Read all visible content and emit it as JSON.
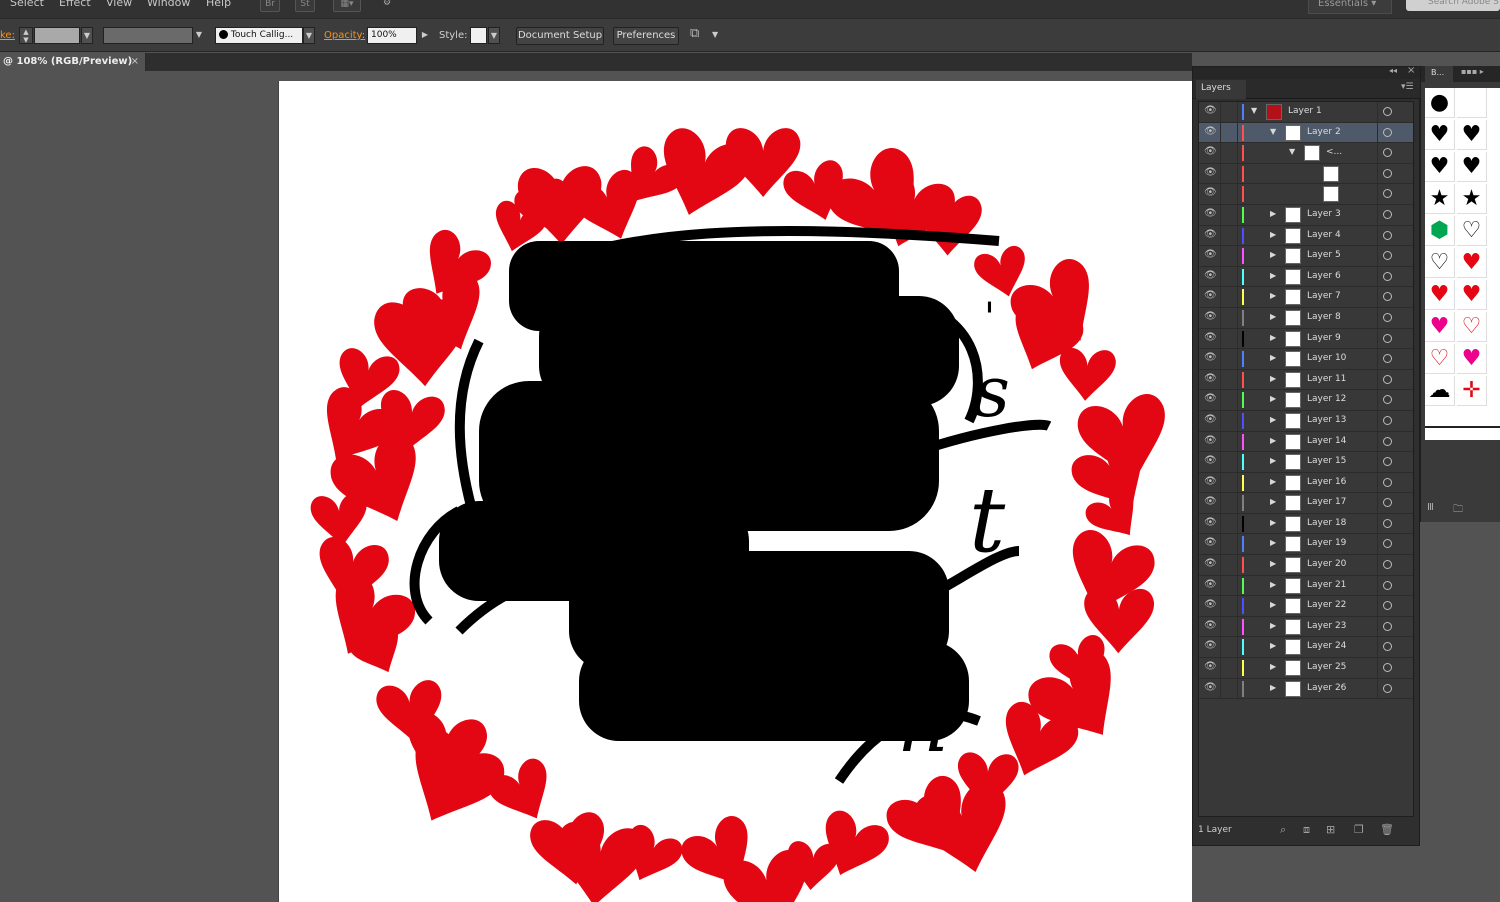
{
  "menubar": {
    "items": [
      "Select",
      "Effect",
      "View",
      "Window",
      "Help"
    ],
    "app_buttons": [
      "Br",
      "St"
    ],
    "workspace": "Essentials",
    "search_placeholder": "Search Adobe S"
  },
  "controlbar": {
    "stroke_label": "ke:",
    "brush_name": "Touch Callig...",
    "opacity_label": "Opacity:",
    "opacity_value": "100%",
    "style_label": "Style:",
    "document_setup": "Document Setup",
    "preferences": "Preferences"
  },
  "document": {
    "tab_title": "@ 108% (RGB/Preview)",
    "close": "×"
  },
  "colors": {
    "heart_red": "#e30613",
    "artboard": "#ffffff",
    "selection": "#4e5a6a"
  },
  "layers_panel": {
    "tab": "Layers",
    "footer_count": "1 Layer",
    "rows": [
      {
        "name": "Layer 1",
        "indent": 0,
        "expanded": true,
        "color": "#4f7fff",
        "selected": false,
        "thumb": "red"
      },
      {
        "name": "Layer 2",
        "indent": 1,
        "expanded": true,
        "color": "#ff4f4f",
        "selected": true,
        "thumb": "text"
      },
      {
        "name": "<...",
        "indent": 2,
        "expanded": true,
        "color": "#ff4f4f",
        "selected": false,
        "thumb": "text"
      },
      {
        "name": "",
        "indent": 3,
        "expanded": null,
        "color": "#ff4f4f",
        "selected": false,
        "thumb": "blank"
      },
      {
        "name": "",
        "indent": 3,
        "expanded": null,
        "color": "#ff4f4f",
        "selected": false,
        "thumb": "text"
      },
      {
        "name": "Layer 3",
        "indent": 1,
        "expanded": false,
        "color": "#4fff4f",
        "selected": false,
        "thumb": "text"
      },
      {
        "name": "Layer 4",
        "indent": 1,
        "expanded": false,
        "color": "#4f4fff",
        "selected": false,
        "thumb": "text"
      },
      {
        "name": "Layer 5",
        "indent": 1,
        "expanded": false,
        "color": "#ff4fff",
        "selected": false,
        "thumb": "text"
      },
      {
        "name": "Layer 6",
        "indent": 1,
        "expanded": false,
        "color": "#4fffff",
        "selected": false,
        "thumb": "text"
      },
      {
        "name": "Layer 7",
        "indent": 1,
        "expanded": false,
        "color": "#ffff4f",
        "selected": false,
        "thumb": "text"
      },
      {
        "name": "Layer 8",
        "indent": 1,
        "expanded": false,
        "color": "#808080",
        "selected": false,
        "thumb": "text"
      },
      {
        "name": "Layer 9",
        "indent": 1,
        "expanded": false,
        "color": "#000000",
        "selected": false,
        "thumb": "text"
      },
      {
        "name": "Layer 10",
        "indent": 1,
        "expanded": false,
        "color": "#4f7fff",
        "selected": false,
        "thumb": "text"
      },
      {
        "name": "Layer 11",
        "indent": 1,
        "expanded": false,
        "color": "#ff4f4f",
        "selected": false,
        "thumb": "text"
      },
      {
        "name": "Layer 12",
        "indent": 1,
        "expanded": false,
        "color": "#4fff4f",
        "selected": false,
        "thumb": "text"
      },
      {
        "name": "Layer 13",
        "indent": 1,
        "expanded": false,
        "color": "#4f4fff",
        "selected": false,
        "thumb": "text"
      },
      {
        "name": "Layer 14",
        "indent": 1,
        "expanded": false,
        "color": "#ff4fff",
        "selected": false,
        "thumb": "text"
      },
      {
        "name": "Layer 15",
        "indent": 1,
        "expanded": false,
        "color": "#4fffff",
        "selected": false,
        "thumb": "text"
      },
      {
        "name": "Layer 16",
        "indent": 1,
        "expanded": false,
        "color": "#ffff4f",
        "selected": false,
        "thumb": "text"
      },
      {
        "name": "Layer 17",
        "indent": 1,
        "expanded": false,
        "color": "#808080",
        "selected": false,
        "thumb": "text"
      },
      {
        "name": "Layer 18",
        "indent": 1,
        "expanded": false,
        "color": "#000000",
        "selected": false,
        "thumb": "text"
      },
      {
        "name": "Layer 19",
        "indent": 1,
        "expanded": false,
        "color": "#4f7fff",
        "selected": false,
        "thumb": "text"
      },
      {
        "name": "Layer 20",
        "indent": 1,
        "expanded": false,
        "color": "#ff4f4f",
        "selected": false,
        "thumb": "text"
      },
      {
        "name": "Layer 21",
        "indent": 1,
        "expanded": false,
        "color": "#4fff4f",
        "selected": false,
        "thumb": "text"
      },
      {
        "name": "Layer 22",
        "indent": 1,
        "expanded": false,
        "color": "#4f4fff",
        "selected": false,
        "thumb": "text"
      },
      {
        "name": "Layer 23",
        "indent": 1,
        "expanded": false,
        "color": "#ff4fff",
        "selected": false,
        "thumb": "text"
      },
      {
        "name": "Layer 24",
        "indent": 1,
        "expanded": false,
        "color": "#4fffff",
        "selected": false,
        "thumb": "text"
      },
      {
        "name": "Layer 25",
        "indent": 1,
        "expanded": false,
        "color": "#ffff4f",
        "selected": false,
        "thumb": "text"
      },
      {
        "name": "Layer 26",
        "indent": 1,
        "expanded": false,
        "color": "#808080",
        "selected": false,
        "thumb": "text"
      }
    ]
  },
  "symbols_panel": {
    "tab": "B...",
    "symbols": [
      {
        "glyph": "●",
        "color": "#000000"
      },
      {
        "glyph": "",
        "color": "#000000"
      },
      {
        "glyph": "♥",
        "color": "#000000"
      },
      {
        "glyph": "♥",
        "color": "#000000"
      },
      {
        "glyph": "♥",
        "color": "#000000"
      },
      {
        "glyph": "♥",
        "color": "#000000"
      },
      {
        "glyph": "★",
        "color": "#000000"
      },
      {
        "glyph": "★",
        "color": "#000000"
      },
      {
        "glyph": "⬢",
        "color": "#00a651"
      },
      {
        "glyph": "♡",
        "color": "#000000"
      },
      {
        "glyph": "♡",
        "color": "#000000"
      },
      {
        "glyph": "♥",
        "color": "#e30613"
      },
      {
        "glyph": "♥",
        "color": "#e30613"
      },
      {
        "glyph": "♥",
        "color": "#e30613"
      },
      {
        "glyph": "♥",
        "color": "#ec008c"
      },
      {
        "glyph": "♡",
        "color": "#e30613"
      },
      {
        "glyph": "♡",
        "color": "#e30613"
      },
      {
        "glyph": "♥",
        "color": "#ec008c"
      },
      {
        "glyph": "☁",
        "color": "#000000"
      },
      {
        "glyph": "✛",
        "color": "#e30613"
      }
    ]
  }
}
